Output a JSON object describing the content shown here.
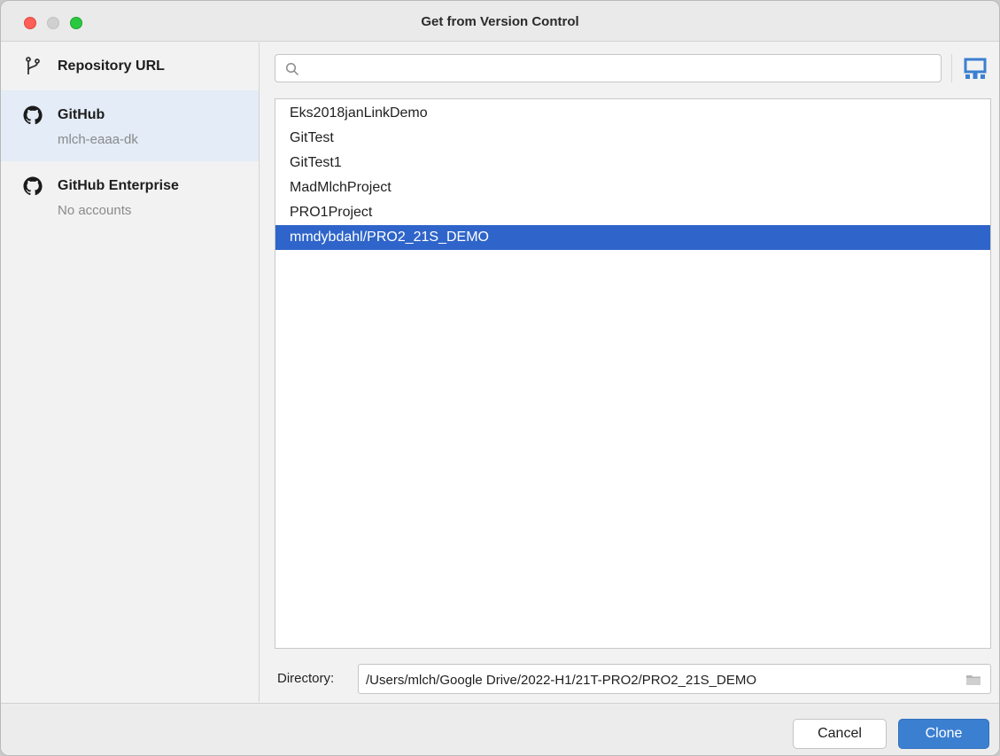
{
  "window": {
    "title": "Get from Version Control"
  },
  "sidebar": {
    "items": [
      {
        "name": "Repository URL",
        "sub": "",
        "icon": "branch-icon"
      },
      {
        "name": "GitHub",
        "sub": "mlch-eaaa-dk",
        "icon": "github-icon",
        "selected": true
      },
      {
        "name": "GitHub Enterprise",
        "sub": "No accounts",
        "icon": "github-icon"
      }
    ]
  },
  "search": {
    "value": "",
    "placeholder": ""
  },
  "repositories": [
    "Eks2018janLinkDemo",
    "GitTest",
    "GitTest1",
    "MadMlchProject",
    "PRO1Project",
    "mmdybdahl/PRO2_21S_DEMO"
  ],
  "selected_repository": "mmdybdahl/PRO2_21S_DEMO",
  "directory": {
    "label": "Directory:",
    "value": "/Users/mlch/Google Drive/2022-H1/21T-PRO2/PRO2_21S_DEMO"
  },
  "buttons": {
    "cancel": "Cancel",
    "clone": "Clone"
  },
  "colors": {
    "selection": "#2f65ca",
    "primary_button": "#3b7fd1",
    "sidebar_selected": "#e3ecf7"
  }
}
